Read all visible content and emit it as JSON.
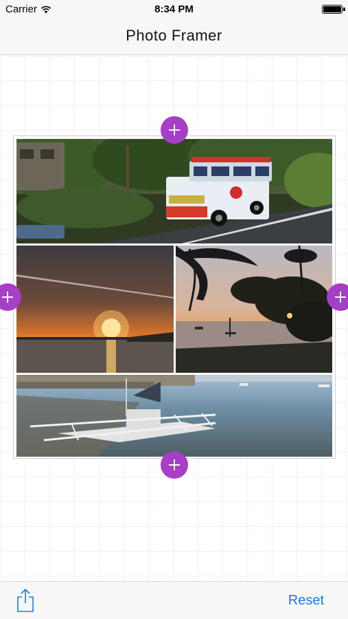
{
  "status_bar": {
    "carrier": "Carrier",
    "time": "8:34 PM",
    "wifi_icon": "wifi-icon",
    "battery_icon": "battery-icon"
  },
  "nav": {
    "title": "Photo Framer"
  },
  "frame": {
    "photos": [
      {
        "name": "jeepney-photo",
        "subject": "jeepney"
      },
      {
        "name": "sunset-photo",
        "subject": "sunset"
      },
      {
        "name": "palm-sunset-photo",
        "subject": "palm sunset"
      },
      {
        "name": "outrigger-boat-photo",
        "subject": "outrigger boat"
      }
    ],
    "add_buttons": [
      "top",
      "left",
      "right",
      "bottom"
    ],
    "add_icon": "plus-icon"
  },
  "toolbar": {
    "share_icon": "share-icon",
    "reset_label": "Reset"
  },
  "colors": {
    "accent": "#a63ec6",
    "tint": "#1a7cf0",
    "bar_background": "#f7f7f7"
  }
}
